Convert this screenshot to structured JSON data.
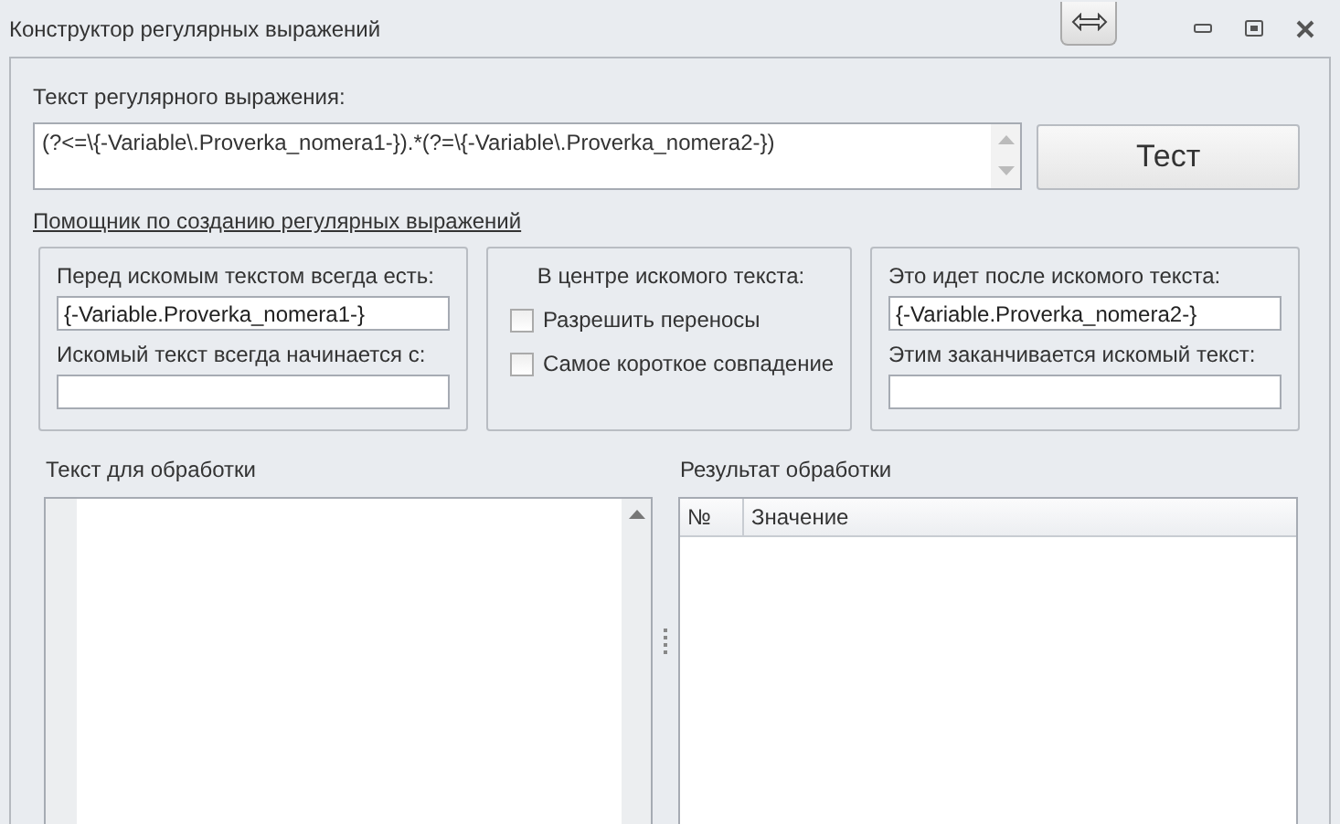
{
  "window": {
    "title": "Конструктор регулярных выражений"
  },
  "regex": {
    "label": "Текст регулярного выражения:",
    "value": "(?<=\\{-Variable\\.Proverka_nomera1-}).*(?=\\{-Variable\\.Proverka_nomera2-})"
  },
  "test_button": "Тест",
  "helper_link": "Помощник по созданию регулярных выражений",
  "before_group": {
    "label": "Перед искомым текстом всегда есть:",
    "value": "{-Variable.Proverka_nomera1-}",
    "start_label": "Искомый текст всегда начинается с:"
  },
  "center_group": {
    "title": "В центре искомого текста:",
    "options": [
      {
        "label": "Разрешить переносы",
        "checked": false
      },
      {
        "label": "Самое короткое совпадение",
        "checked": false
      }
    ]
  },
  "after_group": {
    "label": "Это идет после искомого текста:",
    "value": "{-Variable.Proverka_nomera2-}",
    "end_label": "Этим заканчивается искомый текст:"
  },
  "input_panel": {
    "title": "Текст для обработки"
  },
  "result_panel": {
    "title": "Результат обработки",
    "columns": [
      "№",
      "Значение"
    ]
  }
}
